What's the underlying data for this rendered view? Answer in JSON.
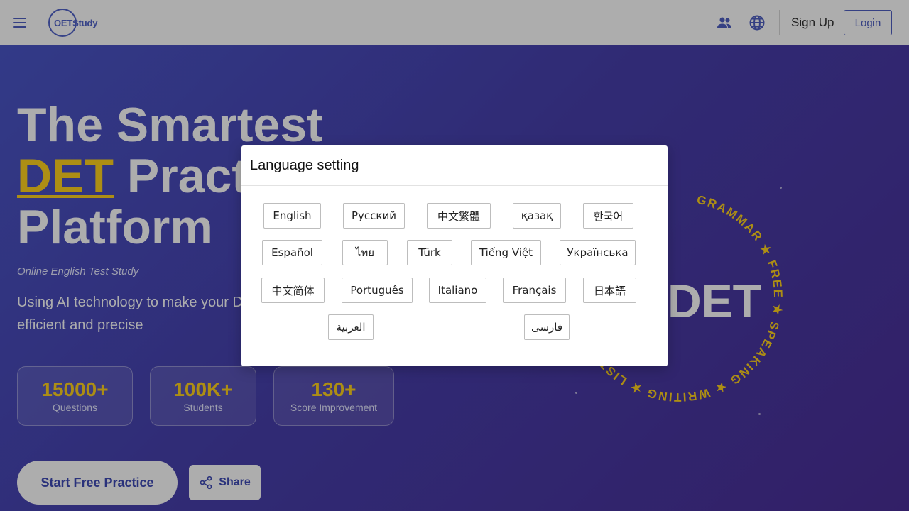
{
  "header": {
    "logo_text": "OETStudy",
    "signup_label": "Sign Up",
    "login_label": "Login"
  },
  "hero": {
    "title_line1": "The Smartest",
    "title_highlight": "DET",
    "title_line2_rest": " Practice",
    "title_line3": "Platform",
    "subtitle": "Online English Test Study",
    "description": "Using AI technology to make your DET preparation more efficient and precise",
    "stats": [
      {
        "value": "15000+",
        "label": "Questions"
      },
      {
        "value": "100K+",
        "label": "Students"
      },
      {
        "value": "130+",
        "label": "Score Improvement"
      }
    ],
    "start_button": "Start Free Practice",
    "share_button": "Share",
    "badge_center": "DET",
    "badge_ring_text": "GRAMMAR ★ FREE ★ SPEAKING ★ WRITING ★ LISTENING ★"
  },
  "modal": {
    "title": "Language setting",
    "languages": [
      "English",
      "Русский",
      "中文繁體",
      "қазақ",
      "한국어",
      "Español",
      "ไทย",
      "Türk",
      "Tiếng Việt",
      "Українська",
      "中文简体",
      "Português",
      "Italiano",
      "Français",
      "日本語",
      "العربية",
      "فارسی"
    ]
  },
  "colors": {
    "accent": "#4f5fc2",
    "highlight": "#ffd21e",
    "hero_bg": "#4840ad"
  }
}
